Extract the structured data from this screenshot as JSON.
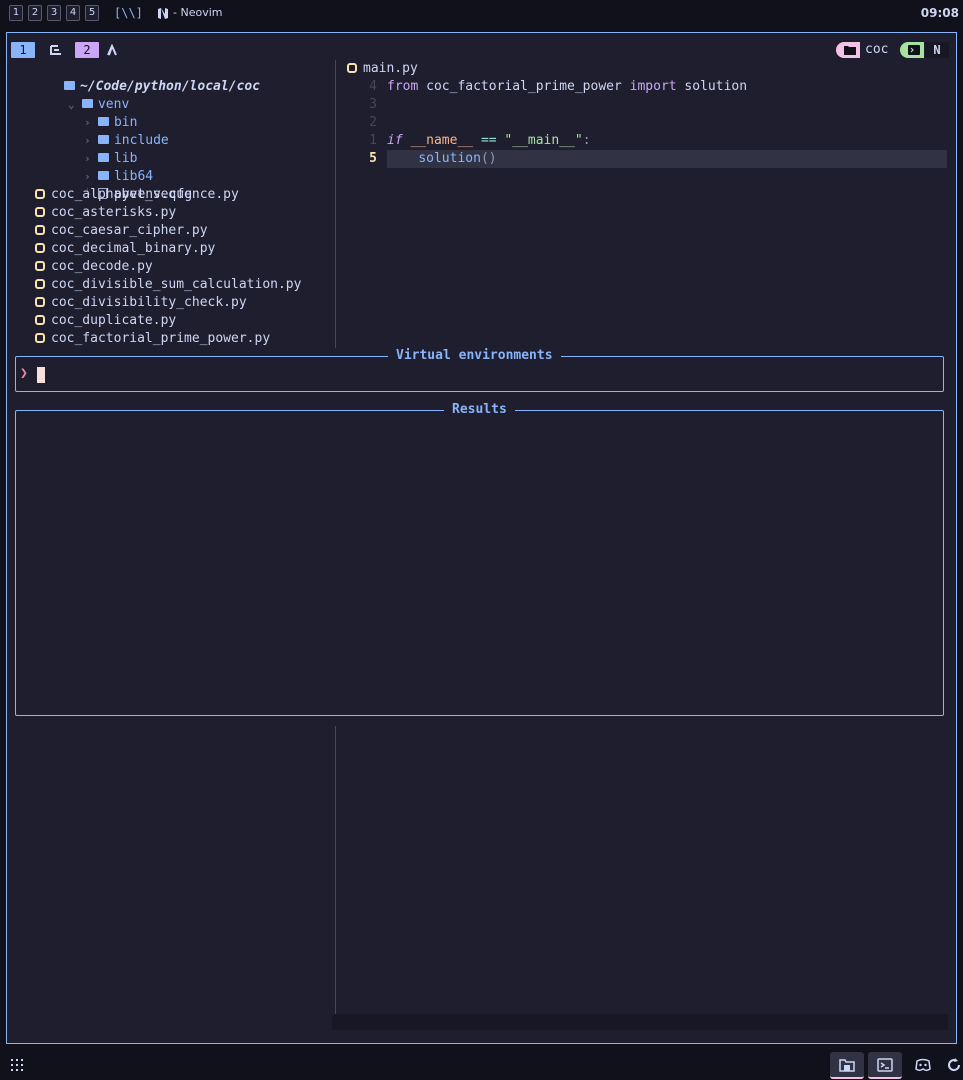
{
  "topbar": {
    "workspaces": [
      "1",
      "2",
      "3",
      "4",
      "5"
    ],
    "layout": "[\\\\]",
    "app_title": "Neovim",
    "clock": "09:08",
    "app_icon": "neovim-icon"
  },
  "tabline": {
    "tab1_number": "1",
    "tab1_icon": "tree-icon",
    "tab2_number": "2",
    "tab2_icon": "lambda-icon",
    "folder_icon": "folder-icon",
    "folder_name": "coc",
    "terminal_icon": "terminal-icon",
    "mode_label": "N"
  },
  "tree": {
    "root": "~/Code/python/local/coc",
    "venv": "venv",
    "venv_children": [
      "bin",
      "include",
      "lib",
      "lib64"
    ],
    "venv_file": "pyvenv.cfg",
    "files": [
      "coc_alphabet_sequence.py",
      "coc_asterisks.py",
      "coc_caesar_cipher.py",
      "coc_decimal_binary.py",
      "coc_decode.py",
      "coc_divisible_sum_calculation.py",
      "coc_divisibility_check.py",
      "coc_duplicate.py",
      "coc_factorial_prime_power.py"
    ]
  },
  "editor": {
    "filename": "main.py",
    "lines": [
      {
        "num": "4",
        "tokens": {
          "kw1": "from",
          "mod": " coc_factorial_prime_power ",
          "kw2": "import",
          "name": " solution"
        }
      },
      {
        "num": "3"
      },
      {
        "num": "2"
      },
      {
        "num": "1",
        "tokens": {
          "kw": "if",
          "var": "__name__",
          "op": "==",
          "str": "\"__main__\"",
          "colon": ":"
        }
      },
      {
        "num": "5",
        "tokens": {
          "fn": "solution",
          "parens": "()"
        }
      }
    ]
  },
  "telescope": {
    "prompt_title": "Virtual environments",
    "prompt_symbol": "❯",
    "prompt_value": "",
    "results_title": "Results"
  },
  "dock": [
    "files-icon",
    "terminal-icon",
    "discord-icon",
    "refresh-icon"
  ],
  "colors": {
    "accent": "#89b4fa",
    "background": "#1e1e2e",
    "pink": "#f5c2e7",
    "green": "#a6e3a1",
    "mauve": "#cba6f7"
  }
}
